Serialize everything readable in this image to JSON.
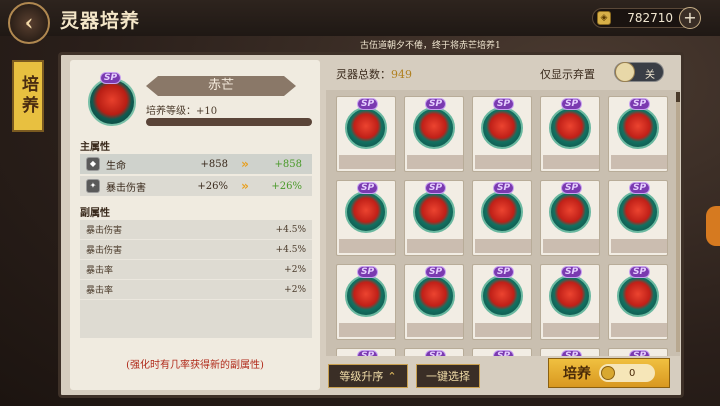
{
  "header": {
    "title": "灵器培养",
    "back_icon": "back-arrow-icon"
  },
  "currency": {
    "value": "782710",
    "icon": "coin-icon"
  },
  "ticker": "古伍道朝夕不倦，终于将赤芒培养1",
  "side_tab": "培养",
  "detail": {
    "rarity": "SP",
    "name": "赤芒",
    "level_label": "培养等级：+10",
    "main_title": "主属性",
    "main_stats": [
      {
        "name": "生命",
        "value": "+858",
        "new": "+858"
      },
      {
        "name": "暴击伤害",
        "value": "+26%",
        "new": "+26%"
      }
    ],
    "sub_title": "副属性",
    "sub_stats": [
      {
        "name": "暴击伤害",
        "value": "+4.5%"
      },
      {
        "name": "暴击伤害",
        "value": "+4.5%"
      },
      {
        "name": "暴击率",
        "value": "+2%"
      },
      {
        "name": "暴击率",
        "value": "+2%"
      }
    ],
    "hint": "(强化时有几率获得新的副属性)"
  },
  "inventory": {
    "total_label": "灵器总数：",
    "total_value": "949",
    "toggle_label": "仅显示弃置",
    "toggle_state": "关",
    "card_rarity": "SP"
  },
  "buttons": {
    "sort": "等级升序",
    "select_all": "一键选择",
    "cultivate": "培养",
    "cultivate_count": "0"
  },
  "colors": {
    "accent": "#e8c040",
    "increase": "#4a9a2a",
    "hint": "#b02a1a"
  }
}
